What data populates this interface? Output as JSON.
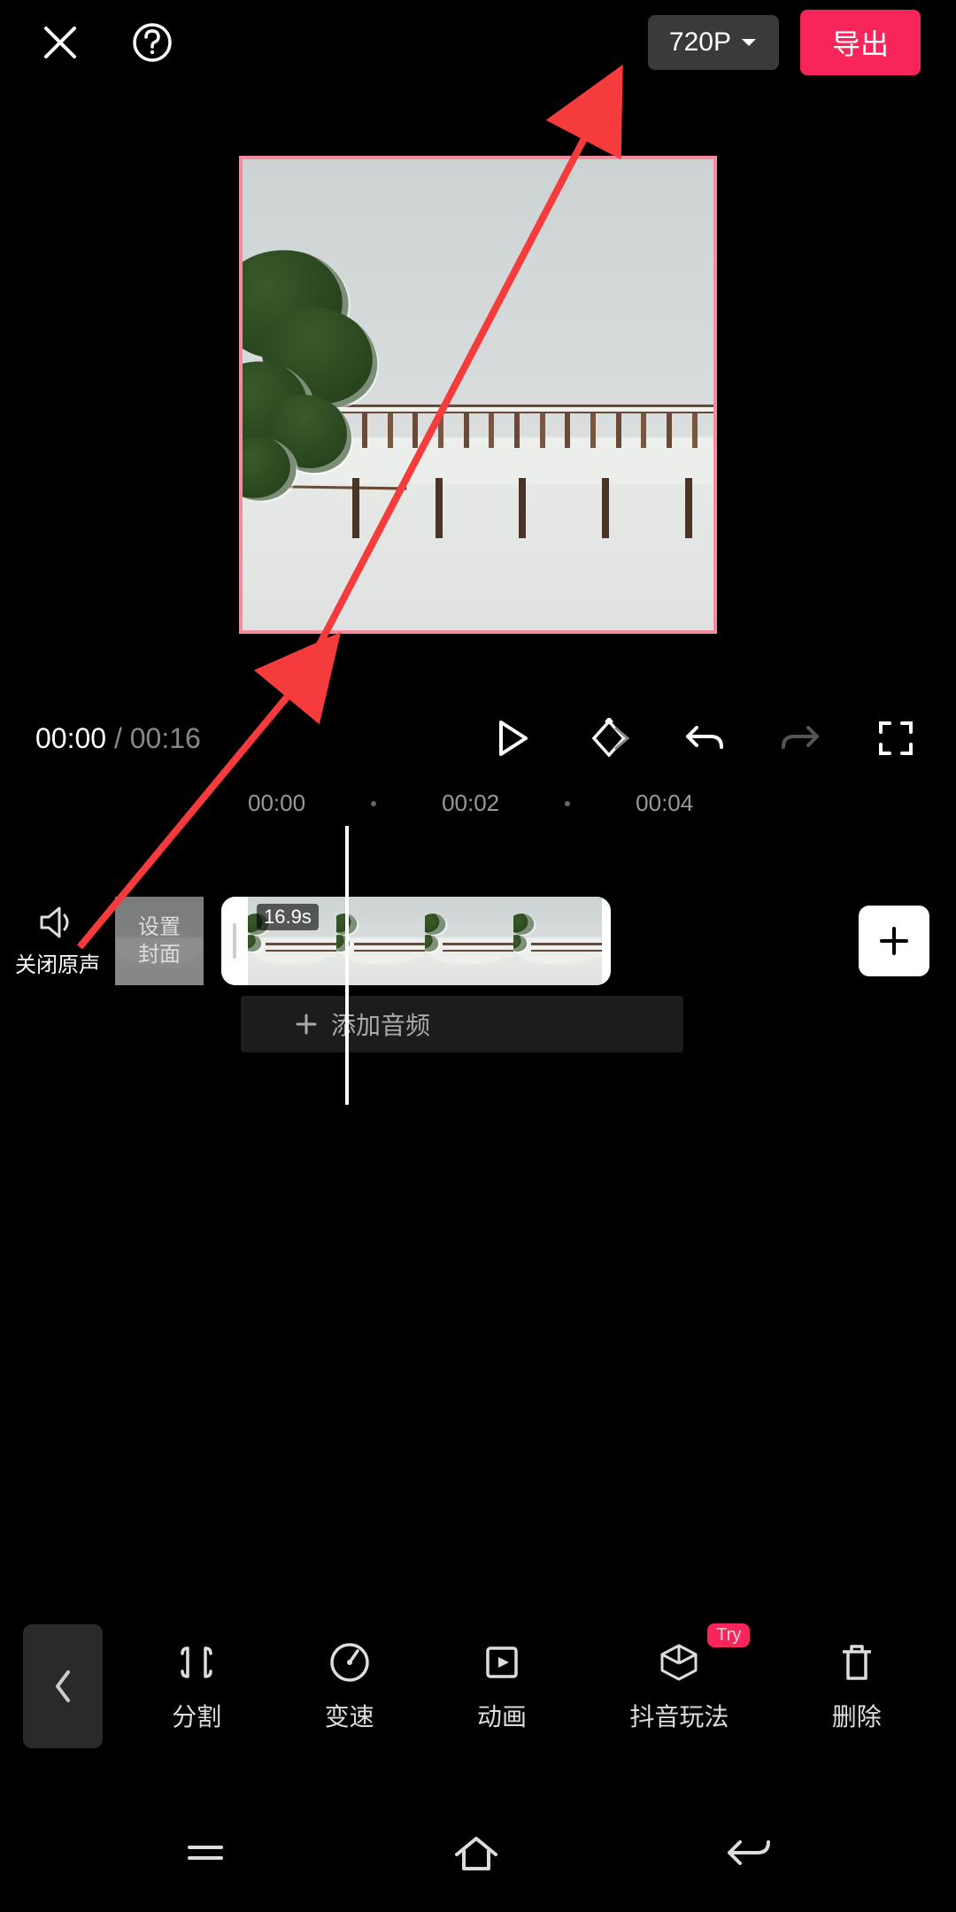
{
  "header": {
    "resolution_label": "720P",
    "export_label": "导出"
  },
  "playback": {
    "current_time": "00:00",
    "separator": " / ",
    "total_time": "00:16"
  },
  "ruler": {
    "marks": [
      "00:00",
      "00:02",
      "00:04"
    ]
  },
  "timeline": {
    "mute_label": "关闭原声",
    "cover_line1": "设置",
    "cover_line2": "封面",
    "clip_duration": "16.9s",
    "add_audio_label": "添加音频"
  },
  "toolbar": {
    "items": [
      {
        "label": "分割"
      },
      {
        "label": "变速"
      },
      {
        "label": "动画"
      },
      {
        "label": "抖音玩法",
        "badge": "Try"
      },
      {
        "label": "删除"
      }
    ]
  }
}
